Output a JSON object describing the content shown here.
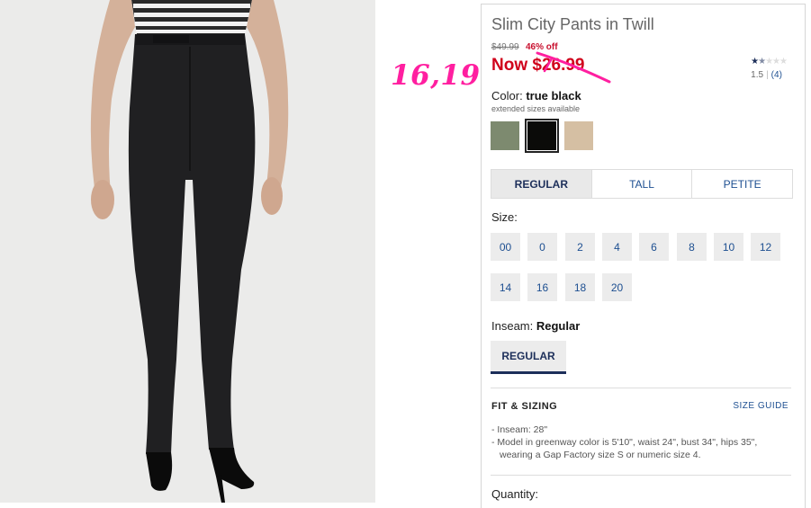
{
  "product": {
    "title": "Slim City Pants in Twill",
    "old_price": "$49.99",
    "percent_off": "46% off",
    "now_price": "Now $26.99"
  },
  "annotation": {
    "text": "16,19",
    "color": "#ff1fa0"
  },
  "rating": {
    "value": 1.5,
    "value_text": "1.5",
    "count_text": "(4)",
    "max_stars": 5
  },
  "color": {
    "label": "Color:",
    "selected": "true black",
    "note": "extended sizes available",
    "swatches": [
      {
        "name": "greenway",
        "hex": "#7d8a6f",
        "selected": false
      },
      {
        "name": "true black",
        "hex": "#0b0b09",
        "selected": true
      },
      {
        "name": "khaki",
        "hex": "#d5bfa3",
        "selected": false
      }
    ]
  },
  "fit_tabs": [
    "REGULAR",
    "TALL",
    "PETITE"
  ],
  "size": {
    "label": "Size:",
    "options": [
      "00",
      "0",
      "2",
      "4",
      "6",
      "8",
      "10",
      "12",
      "14",
      "16",
      "18",
      "20"
    ]
  },
  "inseam": {
    "label": "Inseam:",
    "selected": "Regular",
    "option": "REGULAR"
  },
  "fit_sizing": {
    "title": "FIT & SIZING",
    "guide_link": "SIZE GUIDE",
    "bullets": [
      "- Inseam: 28\"",
      "- Model in greenway color is 5'10\", waist 24\", bust 34\", hips 35\", wearing a Gap Factory size S or numeric size 4."
    ]
  },
  "quantity": {
    "label": "Quantity:"
  },
  "colors": {
    "sale_red": "#d0021b",
    "navy": "#1d2f5a",
    "link_blue": "#1d4f91"
  }
}
